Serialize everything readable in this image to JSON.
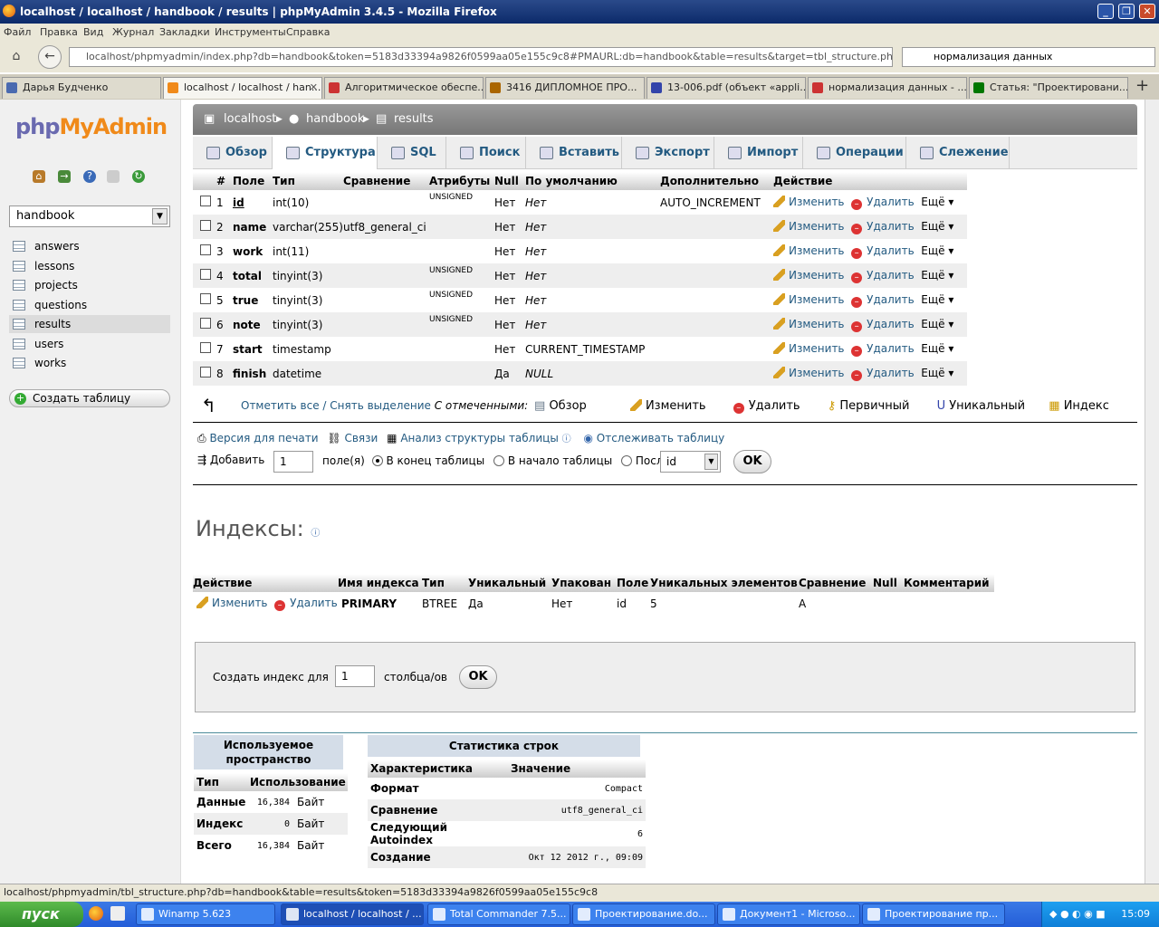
{
  "window": {
    "title": "localhost / localhost / handbook / results | phpMyAdmin 3.4.5 - Mozilla Firefox"
  },
  "menu": [
    "Файл",
    "Правка",
    "Вид",
    "Журнал",
    "Закладки",
    "Инструменты",
    "Справка"
  ],
  "url": "localhost/phpmyadmin/index.php?db=handbook&token=5183d33394a9826f0599aa05e155c9c8#PMAURL:db=handbook&table=results&target=tbl_structure.php&token=5183d",
  "search_value": "нормализация данных",
  "browser_tabs": [
    "Дарья Будченко",
    "localhost / localhost / han...",
    "Алгоритмическое обеспе...",
    "3416 ДИПЛОМНОЕ ПРО...",
    "13-006.pdf (объект «appli...",
    "нормализация данных - ...",
    "Статья: \"Проектировани..."
  ],
  "sidebar": {
    "logo_a": "php",
    "logo_b": "MyAdmin",
    "db_selected": "handbook",
    "tables": [
      "answers",
      "lessons",
      "projects",
      "questions",
      "results",
      "users",
      "works"
    ],
    "create_table": "Создать таблицу"
  },
  "breadcrumb": [
    "localhost",
    "handbook",
    "results"
  ],
  "tabs": [
    "Обзор",
    "Структура",
    "SQL",
    "Поиск",
    "Вставить",
    "Экспорт",
    "Импорт",
    "Операции",
    "Слежение"
  ],
  "structure": {
    "headers": [
      "#",
      "Поле",
      "Тип",
      "Сравнение",
      "Атрибуты",
      "Null",
      "По умолчанию",
      "Дополнительно",
      "Действие"
    ],
    "rows": [
      {
        "n": "1",
        "field": "id",
        "type": "int(10)",
        "collation": "",
        "attr": "UNSIGNED",
        "null": "Нет",
        "default": "Нет",
        "extra": "AUTO_INCREMENT"
      },
      {
        "n": "2",
        "field": "name",
        "type": "varchar(255)",
        "collation": "utf8_general_ci",
        "attr": "",
        "null": "Нет",
        "default": "Нет",
        "extra": ""
      },
      {
        "n": "3",
        "field": "work",
        "type": "int(11)",
        "collation": "",
        "attr": "",
        "null": "Нет",
        "default": "Нет",
        "extra": ""
      },
      {
        "n": "4",
        "field": "total",
        "type": "tinyint(3)",
        "collation": "",
        "attr": "UNSIGNED",
        "null": "Нет",
        "default": "Нет",
        "extra": ""
      },
      {
        "n": "5",
        "field": "true",
        "type": "tinyint(3)",
        "collation": "",
        "attr": "UNSIGNED",
        "null": "Нет",
        "default": "Нет",
        "extra": ""
      },
      {
        "n": "6",
        "field": "note",
        "type": "tinyint(3)",
        "collation": "",
        "attr": "UNSIGNED",
        "null": "Нет",
        "default": "Нет",
        "extra": ""
      },
      {
        "n": "7",
        "field": "start",
        "type": "timestamp",
        "collation": "",
        "attr": "",
        "null": "Нет",
        "default": "CURRENT_TIMESTAMP",
        "extra": ""
      },
      {
        "n": "8",
        "field": "finish",
        "type": "datetime",
        "collation": "",
        "attr": "",
        "null": "Да",
        "default": "NULL",
        "extra": ""
      }
    ],
    "action_edit": "Изменить",
    "action_delete": "Удалить",
    "action_more": "Ещё"
  },
  "bulk": {
    "check_all": "Отметить все / Снять выделение",
    "with_selected": "С отмеченными:",
    "actions": [
      "Обзор",
      "Изменить",
      "Удалить",
      "Первичный",
      "Уникальный",
      "Индекс"
    ]
  },
  "links": [
    "Версия для печати",
    "Связи",
    "Анализ структуры таблицы",
    "Отслеживать таблицу"
  ],
  "add": {
    "label": "Добавить",
    "count": "1",
    "fields": "поле(я)",
    "end": "В конец таблицы",
    "start": "В начало таблицы",
    "after": "После",
    "after_field": "id",
    "ok": "OK"
  },
  "indexes": {
    "title": "Индексы:",
    "headers": [
      "Действие",
      "Имя индекса",
      "Тип",
      "Уникальный",
      "Упакован",
      "Поле",
      "Уникальных элементов",
      "Сравнение",
      "Null",
      "Комментарий"
    ],
    "row": {
      "edit": "Изменить",
      "delete": "Удалить",
      "name": "PRIMARY",
      "type": "BTREE",
      "unique": "Да",
      "packed": "Нет",
      "field": "id",
      "cardinality": "5",
      "collation": "A",
      "null": "",
      "comment": ""
    },
    "create_label": "Создать индекс для",
    "create_count": "1",
    "create_cols": "столбца/ов",
    "ok": "OK"
  },
  "space": {
    "title": "Используемое пространство",
    "headers": [
      "Тип",
      "Использование"
    ],
    "rows": [
      [
        "Данные",
        "16,384",
        "Байт"
      ],
      [
        "Индекс",
        "0",
        "Байт"
      ],
      [
        "Всего",
        "16,384",
        "Байт"
      ]
    ]
  },
  "stats": {
    "title": "Статистика строк",
    "headers": [
      "Характеристика",
      "Значение"
    ],
    "rows": [
      [
        "Формат",
        "Compact"
      ],
      [
        "Сравнение",
        "utf8_general_ci"
      ],
      [
        "Следующий Autoindex",
        "6"
      ],
      [
        "Создание",
        "Окт 12 2012 г., 09:09"
      ]
    ]
  },
  "statusbar": "localhost/phpmyadmin/tbl_structure.php?db=handbook&table=results&token=5183d33394a9826f0599aa05e155c9c8",
  "taskbar": {
    "start": "пуск",
    "tasks": [
      "Winamp 5.623",
      "localhost / localhost / ...",
      "Total Commander 7.5...",
      "Проектирование.do...",
      "Документ1 - Microso...",
      "Проектирование пр..."
    ],
    "clock": "15:09"
  }
}
